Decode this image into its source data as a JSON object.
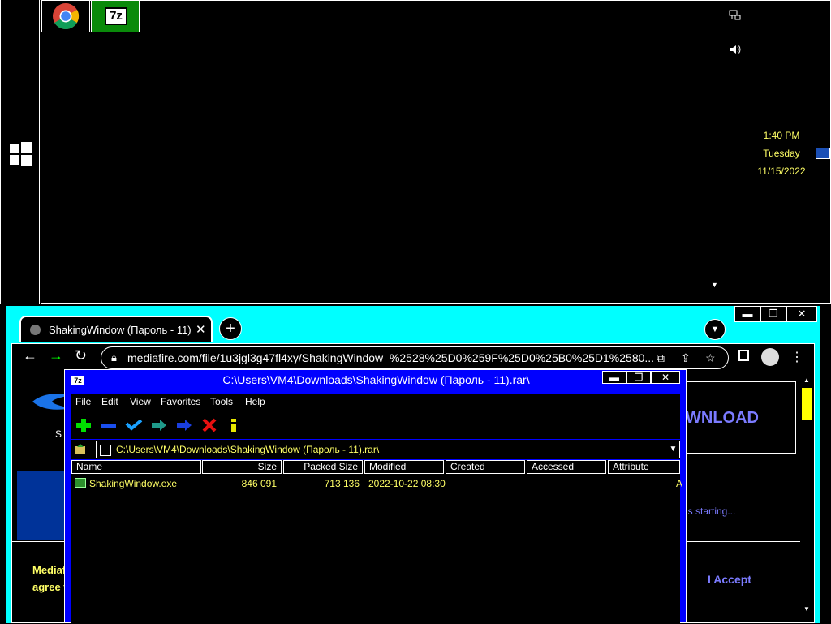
{
  "taskbar": {
    "apps": [
      {
        "name": "Google Chrome",
        "icon": "chrome-icon"
      },
      {
        "name": "7-Zip File Manager",
        "icon": "7zip-icon",
        "label": "7z"
      }
    ],
    "start_icon": "windows-logo-icon"
  },
  "tray": {
    "icons": [
      "network-icon",
      "volume-icon",
      "show-desktop-icon",
      "chevron-down-icon"
    ],
    "time": "1:40 PM",
    "day": "Tuesday",
    "date": "11/15/2022"
  },
  "browser": {
    "tab_title": "ShakingWindow (Пароль - 11)",
    "url": "mediafire.com/file/1u3jgl3g47fl4xy/ShakingWindow_%2528%25D0%259F%25D0%25B0%25D1%2580...",
    "page": {
      "download_label": "WNLOAD",
      "starting_text": "is starting...",
      "bottom_line1": "Mediaf",
      "bottom_line2": "agree t",
      "accept_label": "I Accept",
      "left_letter": "S"
    }
  },
  "zip": {
    "title": "C:\\Users\\VM4\\Downloads\\ShakingWindow (Пароль - 11).rar\\",
    "title_icon_label": "7z",
    "menu": [
      "File",
      "Edit",
      "View",
      "Favorites",
      "Tools",
      "Help"
    ],
    "toolbar": [
      "add-icon",
      "extract-icon",
      "test-icon",
      "copy-icon",
      "move-icon",
      "delete-icon",
      "info-icon"
    ],
    "path": "C:\\Users\\VM4\\Downloads\\ShakingWindow (Пароль - 11).rar\\",
    "columns": [
      "Name",
      "Size",
      "Packed Size",
      "Modified",
      "Created",
      "Accessed",
      "Attribute"
    ],
    "files": [
      {
        "name": "ShakingWindow.exe",
        "size": "846 091",
        "packed": "713 136",
        "modified": "2022-10-22 08:30",
        "created": "",
        "accessed": "",
        "attr": "A"
      }
    ]
  },
  "colors": {
    "accent_cyan": "#00ffff",
    "zip_blue": "#0000ff",
    "text_yellow": "#ffff66",
    "link_purple": "#7b7bff"
  }
}
